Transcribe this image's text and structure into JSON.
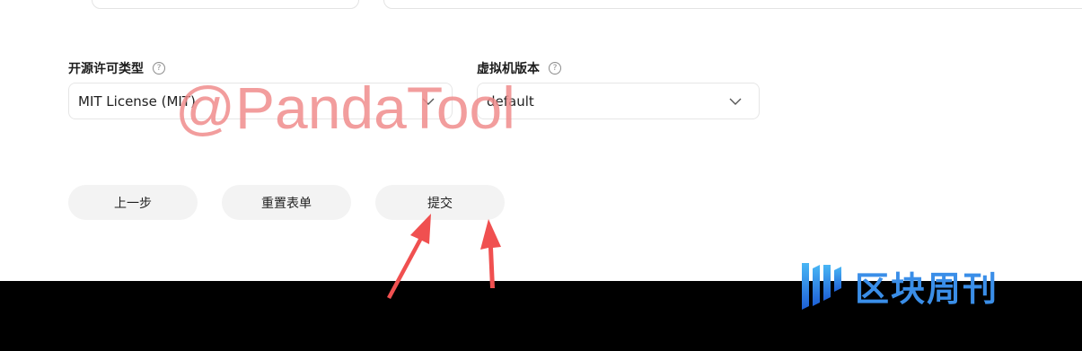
{
  "form": {
    "license_label": "开源许可类型",
    "license_value": "MIT License (MIT)",
    "vm_label": "虚拟机版本",
    "vm_value": "default",
    "help_glyph": "?"
  },
  "buttons": {
    "prev": "上一步",
    "reset": "重置表单",
    "submit": "提交"
  },
  "overlay": {
    "watermark": "@PandaTool",
    "brand": "区块周刊"
  },
  "colors": {
    "watermark": "#f08d8d",
    "arrow": "#f05050",
    "brand": "#3a8ee8",
    "button_bg": "#f3f3f3"
  },
  "icons": {
    "help": "question-circle-icon",
    "select": "chevron-down-icon",
    "pointer": "red-arrow-icon",
    "brand": "brand-logo-icon"
  }
}
